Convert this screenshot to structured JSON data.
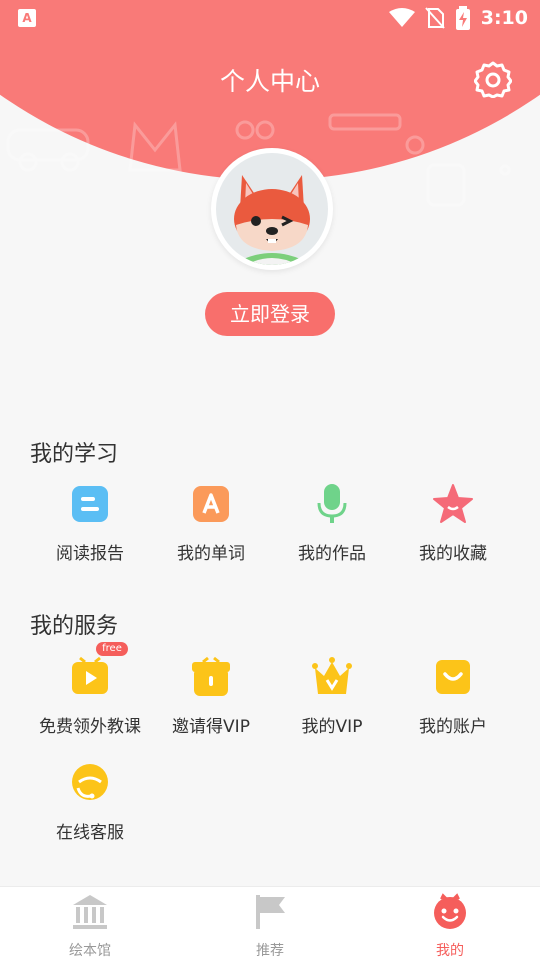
{
  "status_bar": {
    "app_badge": "A",
    "time": "3:10"
  },
  "header": {
    "title": "个人中心"
  },
  "profile": {
    "login_label": "立即登录"
  },
  "study": {
    "title": "我的学习",
    "items": [
      {
        "label": "阅读报告",
        "icon": "report-icon",
        "color": "#5bbef4"
      },
      {
        "label": "我的单词",
        "icon": "word-icon",
        "color": "#fb9a5a"
      },
      {
        "label": "我的作品",
        "icon": "microphone-icon",
        "color": "#6fd38a"
      },
      {
        "label": "我的收藏",
        "icon": "star-icon",
        "color": "#f56a78"
      }
    ]
  },
  "services": {
    "title": "我的服务",
    "items": [
      {
        "label": "免费领外教课",
        "icon": "video-icon",
        "badge": "free",
        "color": "#fcc419"
      },
      {
        "label": "邀请得VIP",
        "icon": "gift-icon",
        "color": "#fcc419"
      },
      {
        "label": "我的VIP",
        "icon": "crown-icon",
        "color": "#fcc419"
      },
      {
        "label": "我的账户",
        "icon": "wallet-icon",
        "color": "#fcc419"
      },
      {
        "label": "在线客服",
        "icon": "customer-service-icon",
        "color": "#fcc419"
      }
    ]
  },
  "bottom_nav": {
    "items": [
      {
        "label": "绘本馆",
        "icon": "library-icon",
        "active": false
      },
      {
        "label": "推荐",
        "icon": "flag-icon",
        "active": false
      },
      {
        "label": "我的",
        "icon": "smiley-icon",
        "active": true
      }
    ]
  },
  "colors": {
    "primary": "#f97a78",
    "accent": "#f55e5b",
    "icon_yellow": "#fcc419"
  }
}
